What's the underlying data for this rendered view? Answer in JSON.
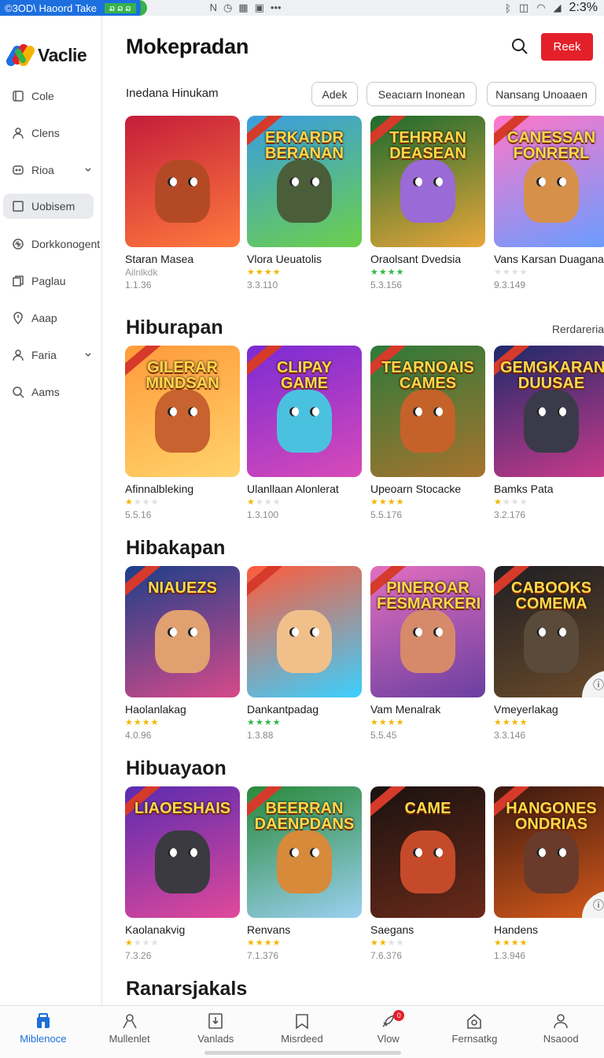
{
  "status_bar": {
    "left_text": "©3OD\\ Haoord Take",
    "alt_text": "ລ ລ ລ",
    "time": "2:3%"
  },
  "sidebar": {
    "brand": "Vaclie",
    "items": [
      {
        "label": "Cole",
        "icon": "page-icon"
      },
      {
        "label": "Clens",
        "icon": "person-icon"
      },
      {
        "label": "Rioa",
        "icon": "grid-icon",
        "expandable": true
      },
      {
        "label": "Uobisem",
        "icon": "square-icon",
        "active": true
      },
      {
        "label": "Dorkkonogent",
        "icon": "gear-icon"
      },
      {
        "label": "Paglau",
        "icon": "copy-icon"
      },
      {
        "label": "Aaap",
        "icon": "pin-icon"
      },
      {
        "label": "Faria",
        "icon": "person-icon",
        "expandable": true
      },
      {
        "label": "Aams",
        "icon": "search-icon"
      }
    ]
  },
  "header": {
    "title": "Mokepradan",
    "cta_label": "Reek"
  },
  "filters": {
    "label": "Inedana Hinukam",
    "chips": [
      "Adek",
      "Seacıarn Inonean",
      "Nansang Unoaaen"
    ]
  },
  "sections": [
    {
      "title": "",
      "more": "",
      "cards": [
        {
          "title": "Staran Masea",
          "sub": "Ailnlkdk",
          "rating": 0,
          "meta": "1.1.36",
          "art": "",
          "color1": "#c41d3a",
          "color2": "#ff7a3d",
          "creature": "#b44a25",
          "star_style": "gold"
        },
        {
          "title": "Vlora Ueuatolis",
          "sub": "",
          "rating": 4,
          "meta": "3.3.110",
          "art": "ERKARDR BERANAN",
          "color1": "#3a9de0",
          "color2": "#6ccf4a",
          "creature": "#4a5e3a",
          "star_style": "gold"
        },
        {
          "title": "Oraolsant Dvedsia",
          "sub": "",
          "rating": 4,
          "meta": "5.3.156",
          "art": "TEHRRAN DEASEAN",
          "color1": "#1b6b2e",
          "color2": "#e8a63a",
          "creature": "#9a6ad6",
          "star_style": "green"
        },
        {
          "title": "Vans Karsan Duaganan",
          "sub": "",
          "rating": 0,
          "meta": "9.3.149",
          "art": "CANESSAN FONRERL",
          "color1": "#ff77c8",
          "color2": "#6a9cff",
          "creature": "#d6904a",
          "star_style": "gold"
        }
      ]
    },
    {
      "title": "Hiburapan",
      "more": "Rerdareria",
      "cards": [
        {
          "title": "Afinnalbleking",
          "sub": "",
          "rating": 1,
          "meta": "5.5.16",
          "art": "GILERAR MINDSAN",
          "color1": "#ff9a3a",
          "color2": "#ffd36b",
          "creature": "#c8622e",
          "star_style": "gold"
        },
        {
          "title": "Ulanllaan Alonlerat",
          "sub": "",
          "rating": 1,
          "meta": "1.3.100",
          "art": "CLIPAY GAME",
          "color1": "#7a2bd4",
          "color2": "#d84ab8",
          "creature": "#4bc1e0",
          "star_style": "gold"
        },
        {
          "title": "Upeoarn Stocacke",
          "sub": "",
          "rating": 4,
          "meta": "5.5.176",
          "art": "TEARNOAIS CAMES",
          "color1": "#2e7a3a",
          "color2": "#a6732e",
          "creature": "#c4622a",
          "star_style": "gold"
        },
        {
          "title": "Bamks Pata",
          "sub": "",
          "rating": 1,
          "meta": "3.2.176",
          "art": "GEMGKARAN DUUSAE",
          "color1": "#1e2a6b",
          "color2": "#c83a8a",
          "creature": "#3a3a4a",
          "star_style": "gold"
        }
      ]
    },
    {
      "title": "Hibakapan",
      "more": "",
      "cards": [
        {
          "title": "Haolanlakag",
          "sub": "",
          "rating": 4,
          "meta": "4.0.96",
          "art": "NIAUEZS",
          "color1": "#1d3f8a",
          "color2": "#d64a8a",
          "creature": "#e0a070",
          "star_style": "gold"
        },
        {
          "title": "Dankantpadag",
          "sub": "",
          "rating": 4,
          "meta": "1.3.88",
          "art": "",
          "color1": "#ff5a3a",
          "color2": "#3ad0ff",
          "creature": "#f1c08a",
          "star_style": "green"
        },
        {
          "title": "Vam Menalrak",
          "sub": "",
          "rating": 4,
          "meta": "5.5.45",
          "art": "PINEROAR FESMARKERI",
          "color1": "#e36fbf",
          "color2": "#6b3fa0",
          "creature": "#d68a6a",
          "star_style": "gold"
        },
        {
          "title": "Vmeyerlakag",
          "sub": "",
          "rating": 4,
          "meta": "3.3.146",
          "art": "CABOOKS COMEMA",
          "color1": "#1f1f24",
          "color2": "#6a4a2a",
          "creature": "#5a4a3a",
          "star_style": "gold"
        }
      ]
    },
    {
      "title": "Hibuayaon",
      "more": "",
      "cards": [
        {
          "title": "Kaolanakvig",
          "sub": "",
          "rating": 1,
          "meta": "7.3.26",
          "art": "LIAOESHAIS",
          "color1": "#5b2bb0",
          "color2": "#e0499a",
          "creature": "#3a3a40",
          "star_style": "gold"
        },
        {
          "title": "Renvans",
          "sub": "",
          "rating": 4,
          "meta": "7.1.376",
          "art": "BEERRAN DAENPDANS",
          "color1": "#2a8a3a",
          "color2": "#9ad0f0",
          "creature": "#d68a3a",
          "star_style": "gold"
        },
        {
          "title": "Saegans",
          "sub": "",
          "rating": 2,
          "meta": "7.6.376",
          "art": "CAME",
          "color1": "#1a1210",
          "color2": "#6a2a1a",
          "creature": "#c44a2a",
          "star_style": "gold"
        },
        {
          "title": "Handens",
          "sub": "",
          "rating": 4,
          "meta": "1.3.946",
          "art": "HANGONES ONDRIAS",
          "color1": "#3a1810",
          "color2": "#d65a1a",
          "creature": "#6a3a2a",
          "star_style": "gold"
        }
      ]
    },
    {
      "title": "Ranarsjakals",
      "more": "",
      "cards": []
    }
  ],
  "bottom_nav": [
    {
      "label": "Miblenoce",
      "icon": "store-icon",
      "active": true
    },
    {
      "label": "Mullenlet",
      "icon": "person-icon"
    },
    {
      "label": "Vanlads",
      "icon": "download-icon"
    },
    {
      "label": "Misrdeed",
      "icon": "bookmark-icon"
    },
    {
      "label": "Vlow",
      "icon": "rocket-icon",
      "badge": "0"
    },
    {
      "label": "Fernsatkg",
      "icon": "home-icon"
    },
    {
      "label": "Nsaood",
      "icon": "account-icon"
    }
  ]
}
